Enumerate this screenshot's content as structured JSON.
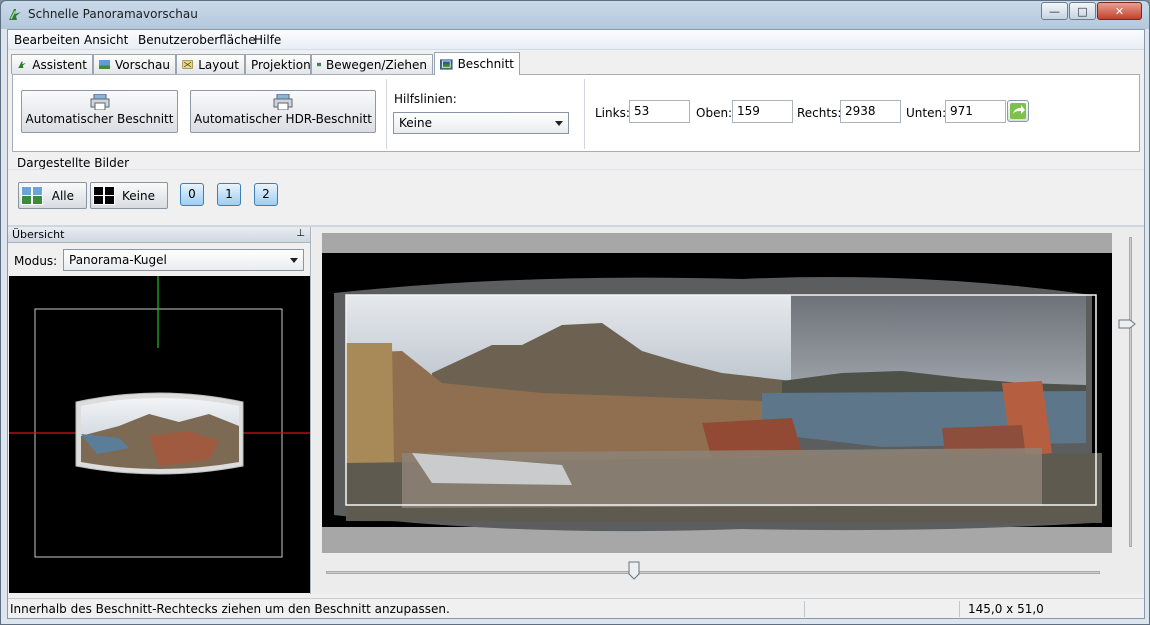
{
  "window": {
    "title": "Schnelle Panoramavorschau",
    "minimize": "—",
    "maximize": "□",
    "close": "✕"
  },
  "menu": [
    "Bearbeiten",
    "Ansicht",
    "Benutzeroberfläche",
    "Hilfe"
  ],
  "tabs": [
    {
      "label": "Assistent",
      "icon": "wizard-icon"
    },
    {
      "label": "Vorschau",
      "icon": "preview-icon"
    },
    {
      "label": "Layout",
      "icon": "layout-icon"
    },
    {
      "label": "Projektion",
      "icon": ""
    },
    {
      "label": "Bewegen/Ziehen",
      "icon": "move-drag-icon"
    },
    {
      "label": "Beschnitt",
      "icon": "crop-icon",
      "active": true
    }
  ],
  "crop": {
    "auto_crop_label": "Automatischer Beschnitt",
    "auto_hdr_crop_label": "Automatischer HDR-Beschnitt",
    "guides_label": "Hilfslinien:",
    "guides_value": "Keine",
    "left_label": "Links:",
    "left_value": "53",
    "top_label": "Oben:",
    "top_value": "159",
    "right_label": "Rechts:",
    "right_value": "2938",
    "bottom_label": "Unten:",
    "bottom_value": "971"
  },
  "shown_images": {
    "label": "Dargestellte Bilder",
    "all_label": "Alle",
    "none_label": "Keine",
    "images": [
      "0",
      "1",
      "2"
    ]
  },
  "overview": {
    "title": "Übersicht",
    "pin": "📌",
    "mode_label": "Modus:",
    "mode_value": "Panorama-Kugel"
  },
  "status": {
    "text": "Innerhalb des Beschnitt-Rechtecks ziehen um den Beschnitt anzupassen.",
    "fov": "145,0 x 51,0"
  },
  "colors": {
    "accent": "#3f7fb5",
    "guide_green": "#22c022",
    "guide_red": "#d01515",
    "background_black": "#000000"
  }
}
